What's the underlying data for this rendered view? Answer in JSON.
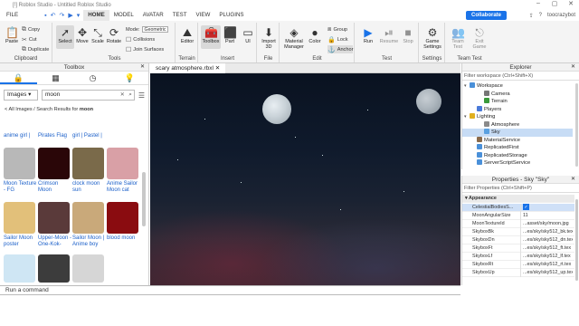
{
  "window": {
    "title": "[!] Roblox Studio - Untitled Roblox Studio",
    "controls": [
      "–",
      "▢",
      "✕"
    ]
  },
  "menu": {
    "quick_actions": [
      "save-icon",
      "undo-icon",
      "redo-icon",
      "play-icon",
      "dropdown-icon"
    ],
    "items": [
      "FILE",
      "HOME",
      "MODEL",
      "AVATAR",
      "TEST",
      "VIEW",
      "PLUGINS"
    ],
    "active": "HOME",
    "collaborate": "Collaborate",
    "user": "toocrazybot"
  },
  "ribbon": {
    "clipboard": {
      "label": "Clipboard",
      "paste": "Paste",
      "copy": "Copy",
      "cut": "Cut",
      "duplicate": "Duplicate"
    },
    "tools": {
      "label": "Tools",
      "select": "Select",
      "move": "Move",
      "scale": "Scale",
      "rotate": "Rotate",
      "mode_label": "Mode:",
      "mode_value": "Geometric",
      "collisions": "Collisions",
      "join": "Join Surfaces"
    },
    "terrain": {
      "label": "Terrain",
      "editor": "Editor"
    },
    "insert": {
      "label": "Insert",
      "toolbox": "Toolbox",
      "part": "Part",
      "ui": "UI"
    },
    "file": {
      "label": "File",
      "import": "Import 3D"
    },
    "edit": {
      "label": "Edit",
      "material": "Material Manager",
      "color": "Color",
      "group": "Group",
      "lock": "Lock",
      "anchor": "Anchor"
    },
    "test": {
      "label": "Test",
      "run": "Run",
      "resume": "Resume",
      "stop": "Stop"
    },
    "settings": {
      "label": "Settings",
      "game": "Game Settings"
    },
    "team": {
      "label": "Team Test",
      "test": "Team Test",
      "exit": "Exit Game"
    }
  },
  "toolbox": {
    "title": "Toolbox",
    "tabs": [
      "lock-icon",
      "grid-icon",
      "clock-icon",
      "bulb-icon"
    ],
    "category": "Images",
    "query": "moon",
    "breadcrumb_prefix": "< All Images / Search Results for ",
    "breadcrumb_query": "moon",
    "top_labels": [
      "anime girl |",
      "Pirates Flag",
      "girl | Pastel |"
    ],
    "items": [
      {
        "name": "Moon Texture - FG",
        "color": "#b8b8b8"
      },
      {
        "name": "Crimson Moon",
        "color": "#2a0608"
      },
      {
        "name": "clock moon sun",
        "color": "#7a6a4a"
      },
      {
        "name": "Anime Sailor Moon cat",
        "color": "#d9a0a6"
      },
      {
        "name": "Sailor Moon poster",
        "color": "#e2c07a"
      },
      {
        "name": "Upper-Moon -One-Kok-",
        "color": "#5a3a3a"
      },
      {
        "name": "Sailor Moon | Anime boy",
        "color": "#c9a97a"
      },
      {
        "name": "blood moon",
        "color": "#8a0c10"
      },
      {
        "name": "",
        "color": "#cfe6f4"
      },
      {
        "name": "",
        "color": "#3c3c3c"
      },
      {
        "name": "",
        "color": "#d6d6d6"
      }
    ]
  },
  "viewport": {
    "tab": "scary atmosphere.rbxl",
    "close": "✕"
  },
  "explorer": {
    "title": "Explorer",
    "filter": "Filter workspace (Ctrl+Shift+X)",
    "items": [
      {
        "label": "Workspace",
        "depth": 0,
        "arrow": "▾",
        "color": "#4a90d9"
      },
      {
        "label": "Camera",
        "depth": 2,
        "arrow": "",
        "color": "#777"
      },
      {
        "label": "Terrain",
        "depth": 2,
        "arrow": "",
        "color": "#3a9a3a"
      },
      {
        "label": "Players",
        "depth": 1,
        "arrow": "",
        "color": "#4a7ad9"
      },
      {
        "label": "Lighting",
        "depth": 0,
        "arrow": "▾",
        "color": "#e0b020"
      },
      {
        "label": "Atmosphere",
        "depth": 2,
        "arrow": "",
        "color": "#8a8a8a"
      },
      {
        "label": "Sky",
        "depth": 2,
        "arrow": "",
        "color": "#5aa0e0",
        "selected": true
      },
      {
        "label": "MaterialService",
        "depth": 1,
        "arrow": "",
        "color": "#8a6a4a"
      },
      {
        "label": "ReplicatedFirst",
        "depth": 1,
        "arrow": "",
        "color": "#4a90d9"
      },
      {
        "label": "ReplicatedStorage",
        "depth": 1,
        "arrow": "",
        "color": "#4a90d9"
      },
      {
        "label": "ServerScriptService",
        "depth": 1,
        "arrow": "",
        "color": "#4a90d9"
      }
    ]
  },
  "properties": {
    "title": "Properties - Sky \"Sky\"",
    "filter": "Filter Properties (Ctrl+Shift+P)",
    "section": "Appearance",
    "rows": [
      {
        "key": "CelestialBodiesS...",
        "value": "✓"
      },
      {
        "key": "MoonAngularSize",
        "value": "11"
      },
      {
        "key": "MoonTextureId",
        "value": "...asset/sky/moon.jpg"
      },
      {
        "key": "SkyboxBk",
        "value": "...es/sky/sky512_bk.tex"
      },
      {
        "key": "SkyboxDn",
        "value": "...es/sky/sky512_dn.tex"
      },
      {
        "key": "SkyboxFt",
        "value": "...es/sky/sky512_ft.tex"
      },
      {
        "key": "SkyboxLf",
        "value": "...es/sky/sky512_lf.tex"
      },
      {
        "key": "SkyboxRt",
        "value": "...es/sky/sky512_rt.tex"
      },
      {
        "key": "SkyboxUp",
        "value": "...es/sky/sky512_up.tex"
      }
    ]
  },
  "command_bar": {
    "placeholder": "Run a command"
  }
}
